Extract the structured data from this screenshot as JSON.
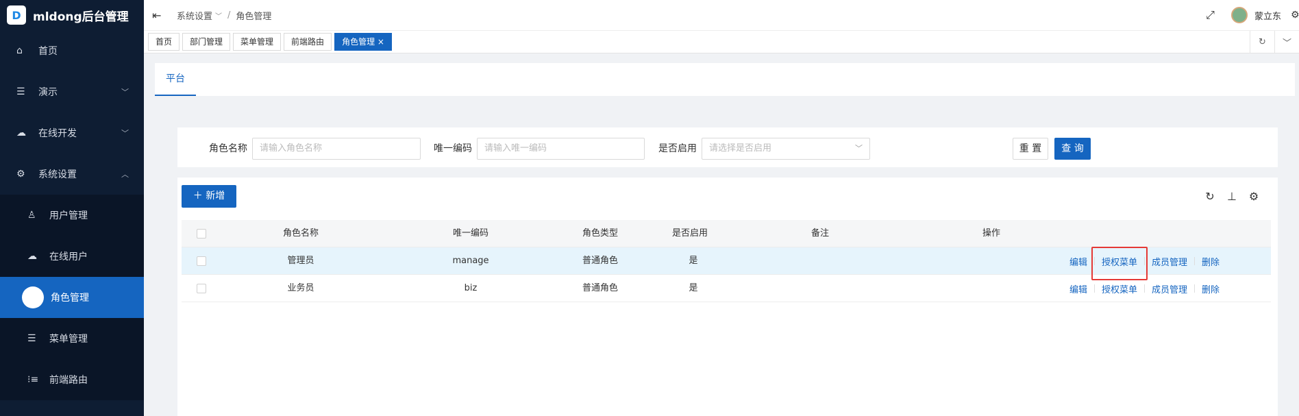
{
  "app": {
    "title": "mldong后台管理",
    "logo_letter": "D"
  },
  "sidebar": {
    "items": [
      {
        "label": "首页",
        "icon": "home-icon"
      },
      {
        "label": "演示",
        "icon": "list-icon"
      },
      {
        "label": "在线开发",
        "icon": "cloud-icon"
      },
      {
        "label": "系统设置",
        "icon": "gear-icon"
      }
    ],
    "subitems": [
      {
        "label": "用户管理",
        "icon": "user-icon"
      },
      {
        "label": "在线用户",
        "icon": "cloud-user-icon"
      },
      {
        "label": "角色管理",
        "icon": "role-icon"
      },
      {
        "label": "菜单管理",
        "icon": "menu-icon"
      },
      {
        "label": "前端路由",
        "icon": "route-icon"
      }
    ]
  },
  "header": {
    "breadcrumb": [
      "系统设置",
      "角色管理"
    ],
    "user_name": "蒙立东"
  },
  "tabs": [
    "首页",
    "部门管理",
    "菜单管理",
    "前端路由",
    "角色管理"
  ],
  "active_tab_close": "×",
  "inner_tab": "平台",
  "filter": {
    "role_name_label": "角色名称",
    "role_name_placeholder": "请输入角色名称",
    "code_label": "唯一编码",
    "code_placeholder": "请输入唯一编码",
    "enabled_label": "是否启用",
    "enabled_placeholder": "请选择是否启用",
    "reset": "重 置",
    "query": "查 询"
  },
  "toolbar": {
    "add": "新增"
  },
  "table": {
    "columns": [
      "角色名称",
      "唯一编码",
      "角色类型",
      "是否启用",
      "备注",
      "操作"
    ],
    "rows": [
      {
        "name": "管理员",
        "code": "manage",
        "type": "普通角色",
        "enabled": "是",
        "remark": ""
      },
      {
        "name": "业务员",
        "code": "biz",
        "type": "普通角色",
        "enabled": "是",
        "remark": ""
      }
    ],
    "ops": [
      "编辑",
      "授权菜单",
      "成员管理",
      "删除"
    ]
  },
  "colors": {
    "primary": "#1565c0",
    "sidebar_bg": "#0e1d33",
    "highlight_box": "#e53935"
  }
}
